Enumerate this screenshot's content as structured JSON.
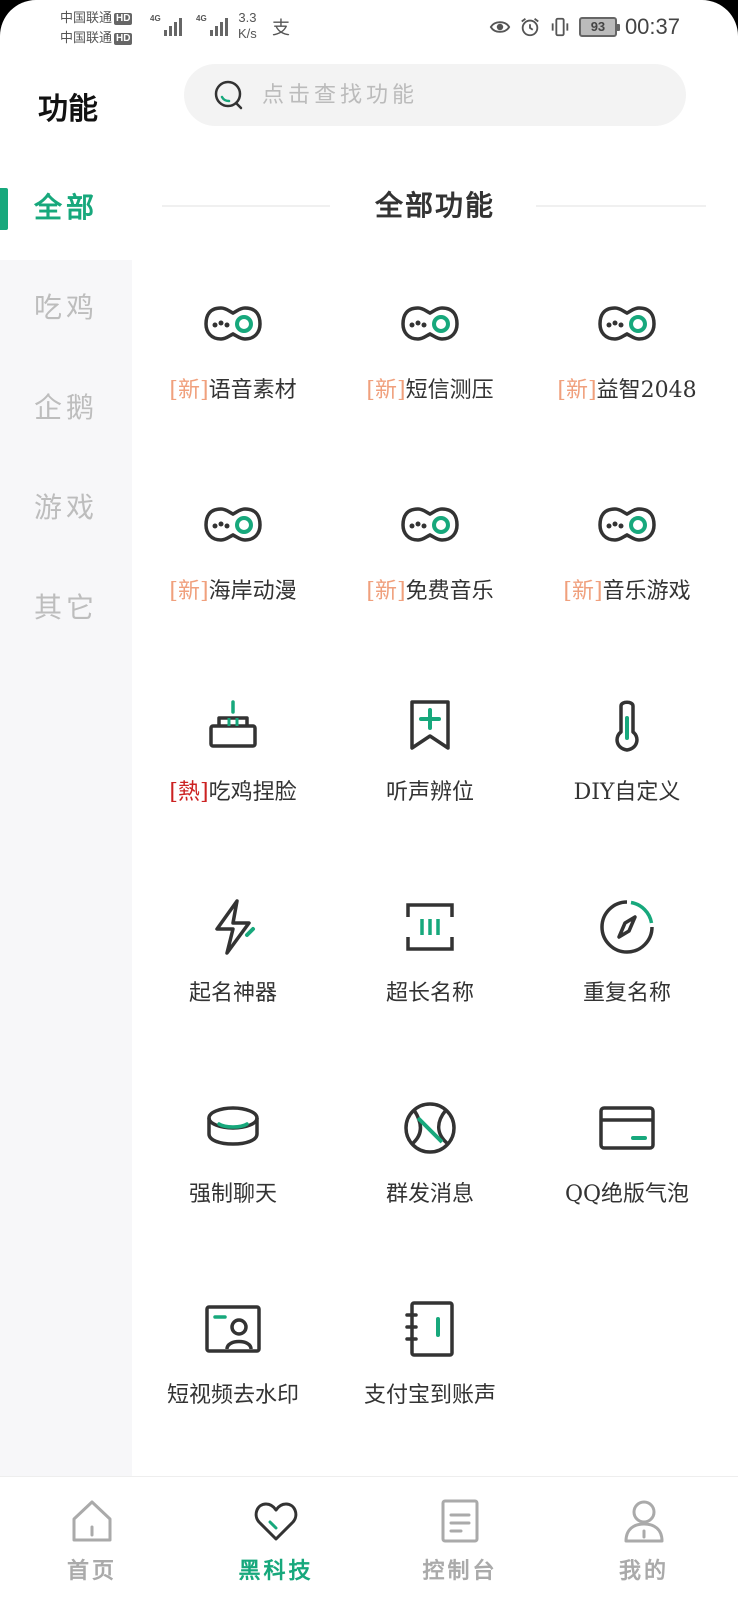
{
  "status_bar": {
    "carrier1": "中国联通",
    "carrier2": "中国联通",
    "hd_badge": "HD",
    "network1": "4G",
    "network2": "4G",
    "speed_value": "3.3",
    "speed_unit": "K/s",
    "notification_icon": "alipay-icon",
    "battery": "93",
    "time": "00:37"
  },
  "header": {
    "title": "功能",
    "search_placeholder": "点击查找功能"
  },
  "sidebar": {
    "items": [
      {
        "label": "全部",
        "active": true
      },
      {
        "label": "吃鸡",
        "active": false
      },
      {
        "label": "企鹅",
        "active": false
      },
      {
        "label": "游戏",
        "active": false
      },
      {
        "label": "其它",
        "active": false
      }
    ]
  },
  "section": {
    "title": "全部功能"
  },
  "features": [
    {
      "tag": "[新]",
      "tag_type": "new",
      "name": "语音素材",
      "icon": "game-controller-icon"
    },
    {
      "tag": "[新]",
      "tag_type": "new",
      "name": "短信测压",
      "icon": "game-controller-icon"
    },
    {
      "tag": "[新]",
      "tag_type": "new",
      "name": "益智2048",
      "icon": "game-controller-icon"
    },
    {
      "tag": "[新]",
      "tag_type": "new",
      "name": "海岸动漫",
      "icon": "game-controller-icon"
    },
    {
      "tag": "[新]",
      "tag_type": "new",
      "name": "免费音乐",
      "icon": "game-controller-icon"
    },
    {
      "tag": "[新]",
      "tag_type": "new",
      "name": "音乐游戏",
      "icon": "game-controller-icon"
    },
    {
      "tag": "[熱]",
      "tag_type": "hot",
      "name": "吃鸡捏脸",
      "icon": "cake-icon"
    },
    {
      "tag": "",
      "tag_type": "",
      "name": "听声辨位",
      "icon": "bookmark-plus-icon"
    },
    {
      "tag": "",
      "tag_type": "",
      "name": "DIY自定义",
      "icon": "thermometer-icon"
    },
    {
      "tag": "",
      "tag_type": "",
      "name": "起名神器",
      "icon": "lightning-icon"
    },
    {
      "tag": "",
      "tag_type": "",
      "name": "超长名称",
      "icon": "scan-frame-icon"
    },
    {
      "tag": "",
      "tag_type": "",
      "name": "重复名称",
      "icon": "compass-icon"
    },
    {
      "tag": "",
      "tag_type": "",
      "name": "强制聊天",
      "icon": "coins-icon"
    },
    {
      "tag": "",
      "tag_type": "",
      "name": "群发消息",
      "icon": "basketball-icon"
    },
    {
      "tag": "",
      "tag_type": "",
      "name": "QQ绝版气泡",
      "icon": "card-icon"
    },
    {
      "tag": "",
      "tag_type": "",
      "name": "短视频去水印",
      "icon": "id-card-icon"
    },
    {
      "tag": "",
      "tag_type": "",
      "name": "支付宝到账声",
      "icon": "notebook-icon"
    }
  ],
  "bottom_nav": [
    {
      "label": "首页",
      "icon": "home-icon",
      "active": false
    },
    {
      "label": "黑科技",
      "icon": "heart-icon",
      "active": true
    },
    {
      "label": "控制台",
      "icon": "document-icon",
      "active": false
    },
    {
      "label": "我的",
      "icon": "user-icon",
      "active": false
    }
  ],
  "colors": {
    "accent": "#17a87c",
    "icon_stroke": "#333333",
    "tag_new": "#f0a07d",
    "tag_hot": "#cc2222",
    "sidebar_bg": "#f7f7f9"
  }
}
